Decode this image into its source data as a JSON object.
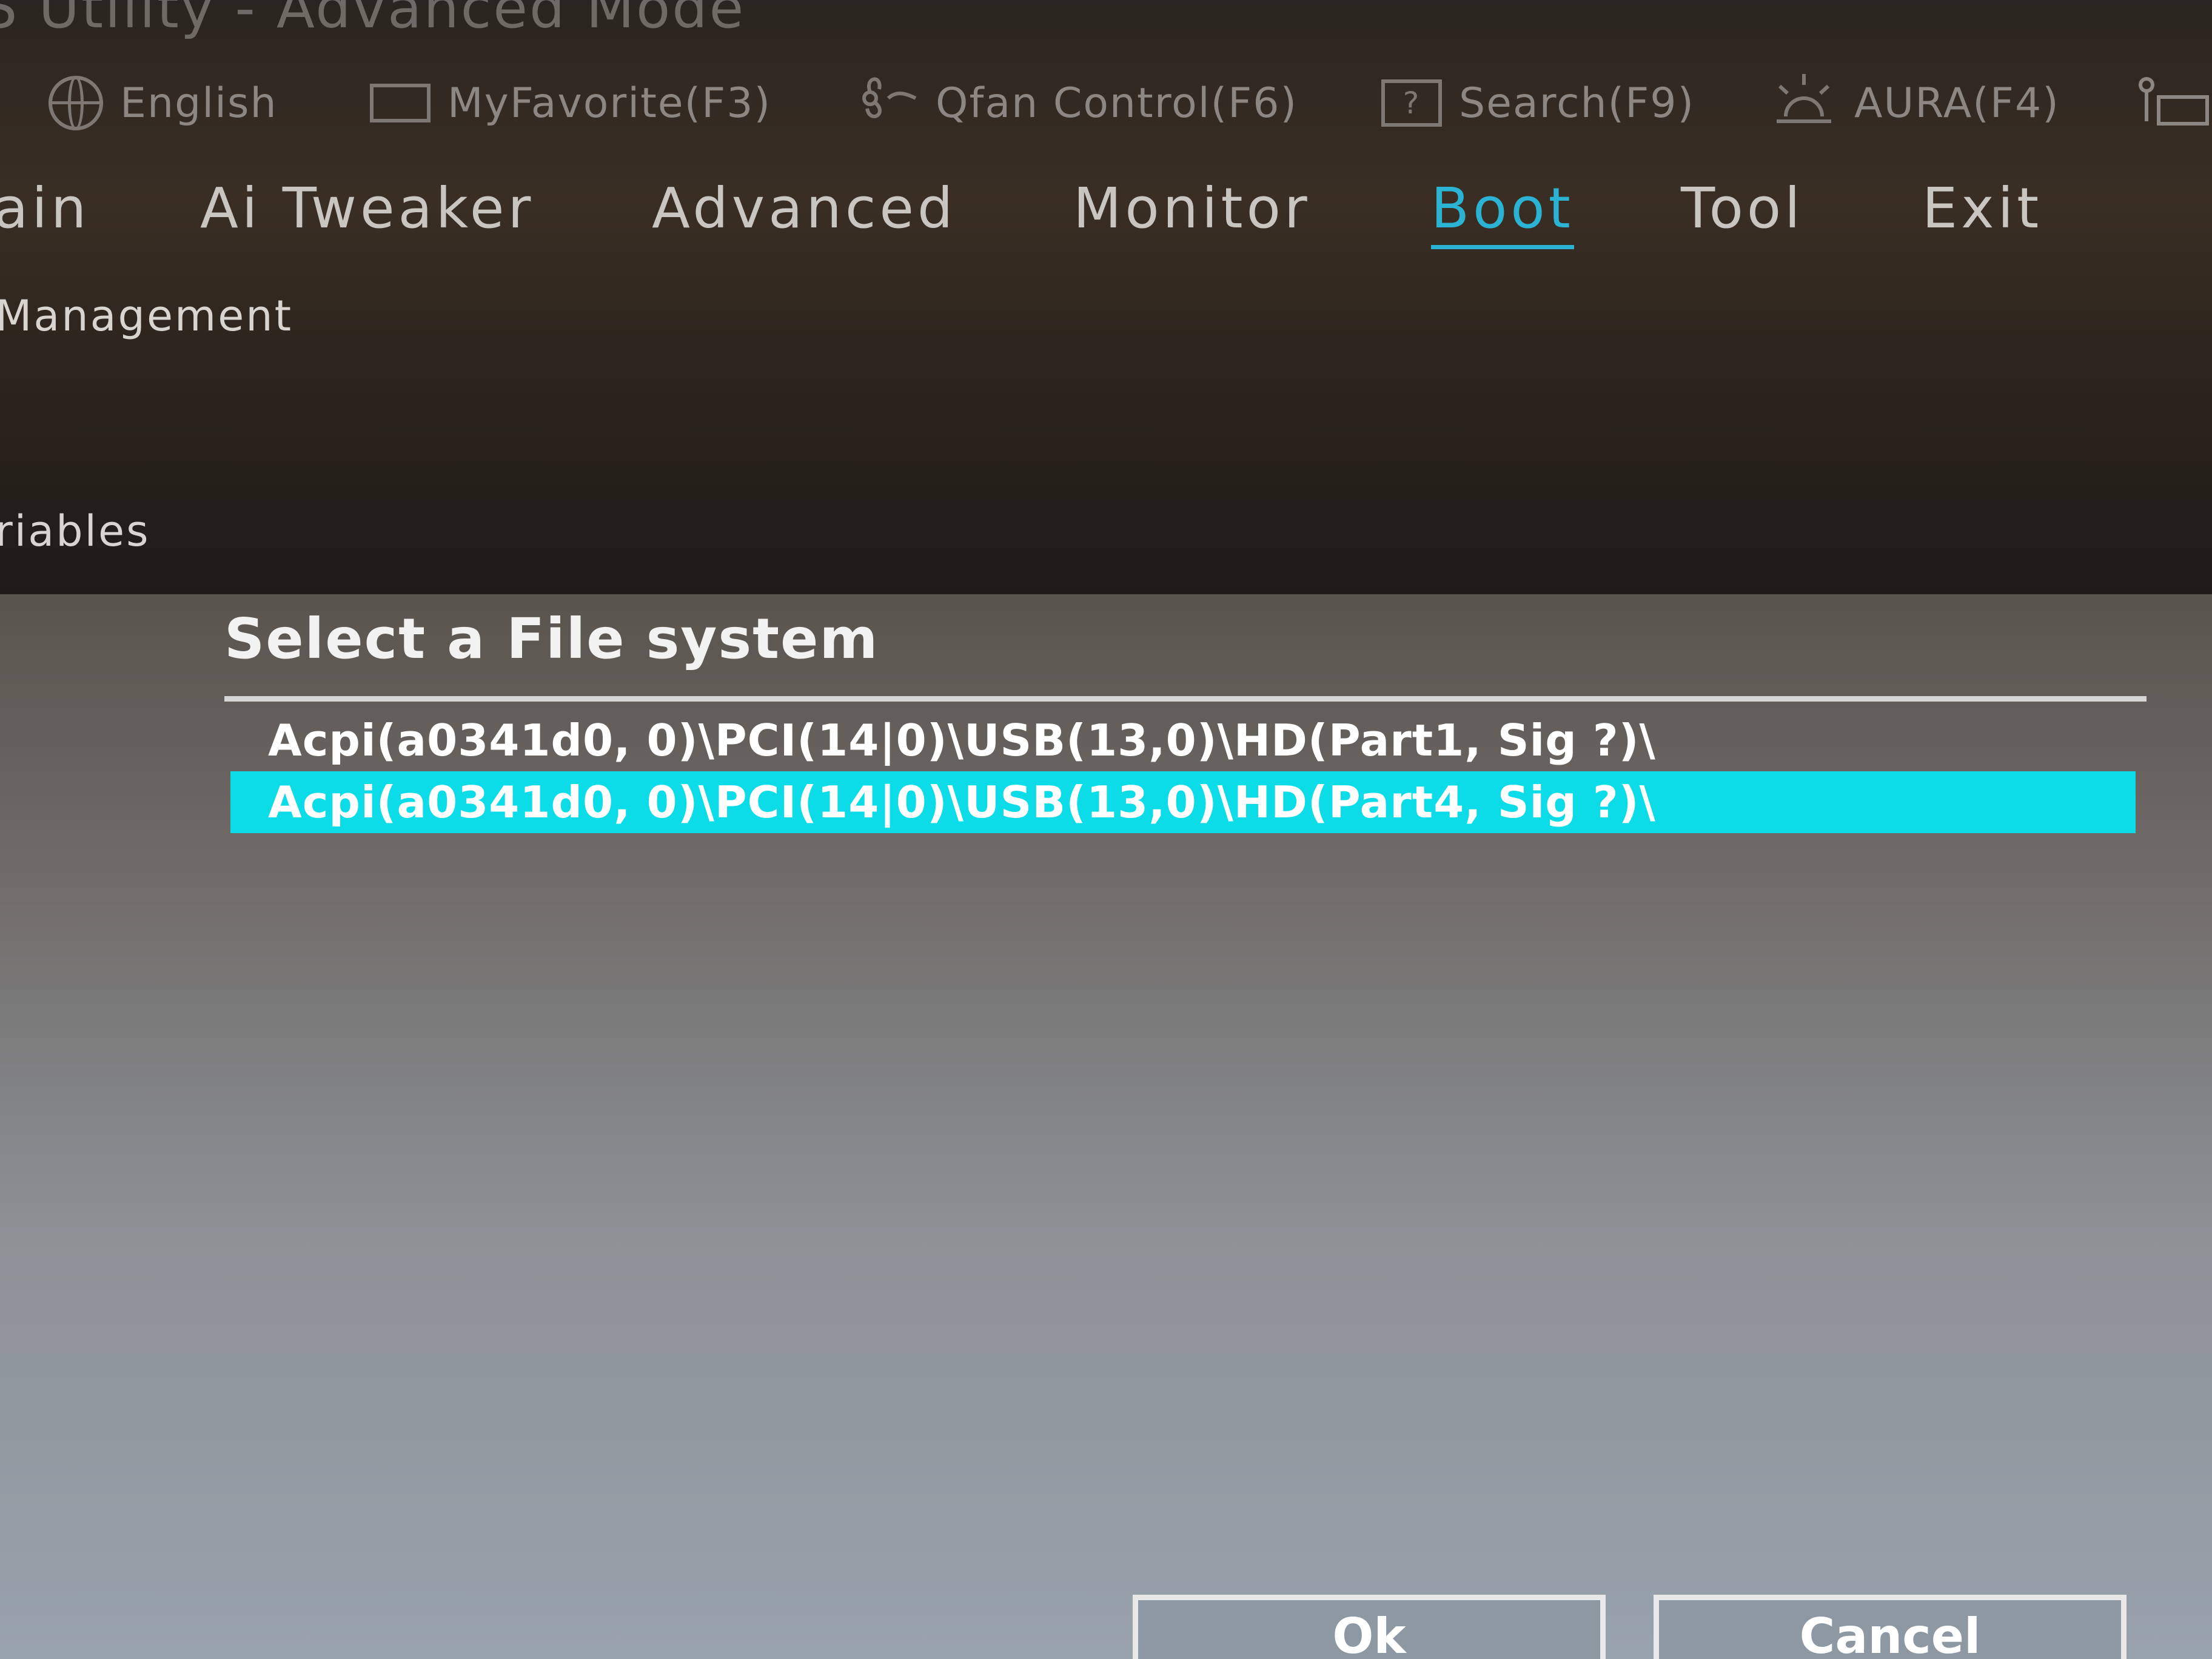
{
  "window": {
    "title": "S Utility - Advanced Mode"
  },
  "utility_bar": {
    "items": [
      {
        "label": "English",
        "icon": "globe-icon"
      },
      {
        "label": "MyFavorite(F3)",
        "icon": "favorite-icon"
      },
      {
        "label": "Qfan Control(F6)",
        "icon": "fan-icon"
      },
      {
        "label": "Search(F9)",
        "icon": "help-icon"
      },
      {
        "label": "AURA(F4)",
        "icon": "aura-light-icon"
      }
    ]
  },
  "main_menu": {
    "tabs": [
      {
        "label": "ain",
        "active": false
      },
      {
        "label": "Ai Tweaker",
        "active": false
      },
      {
        "label": "Advanced",
        "active": false
      },
      {
        "label": "Monitor",
        "active": false
      },
      {
        "label": "Boot",
        "active": true
      },
      {
        "label": "Tool",
        "active": false
      },
      {
        "label": "Exit",
        "active": false
      }
    ],
    "accent_color": "#2bb3d3"
  },
  "sidebar": {
    "items": [
      {
        "label": "Management"
      },
      {
        "label": "riables"
      }
    ]
  },
  "dialog": {
    "title": "Select a File system",
    "items": [
      {
        "label": "Acpi(a0341d0, 0)\\PCI(14|0)\\USB(13,0)\\HD(Part1, Sig ?)\\",
        "selected": false
      },
      {
        "label": "Acpi(a0341d0, 0)\\PCI(14|0)\\USB(13,0)\\HD(Part4, Sig ?)\\",
        "selected": true
      }
    ],
    "selection_color": "#0bdce8",
    "buttons": {
      "ok_label": "Ok",
      "cancel_label": "Cancel"
    }
  }
}
